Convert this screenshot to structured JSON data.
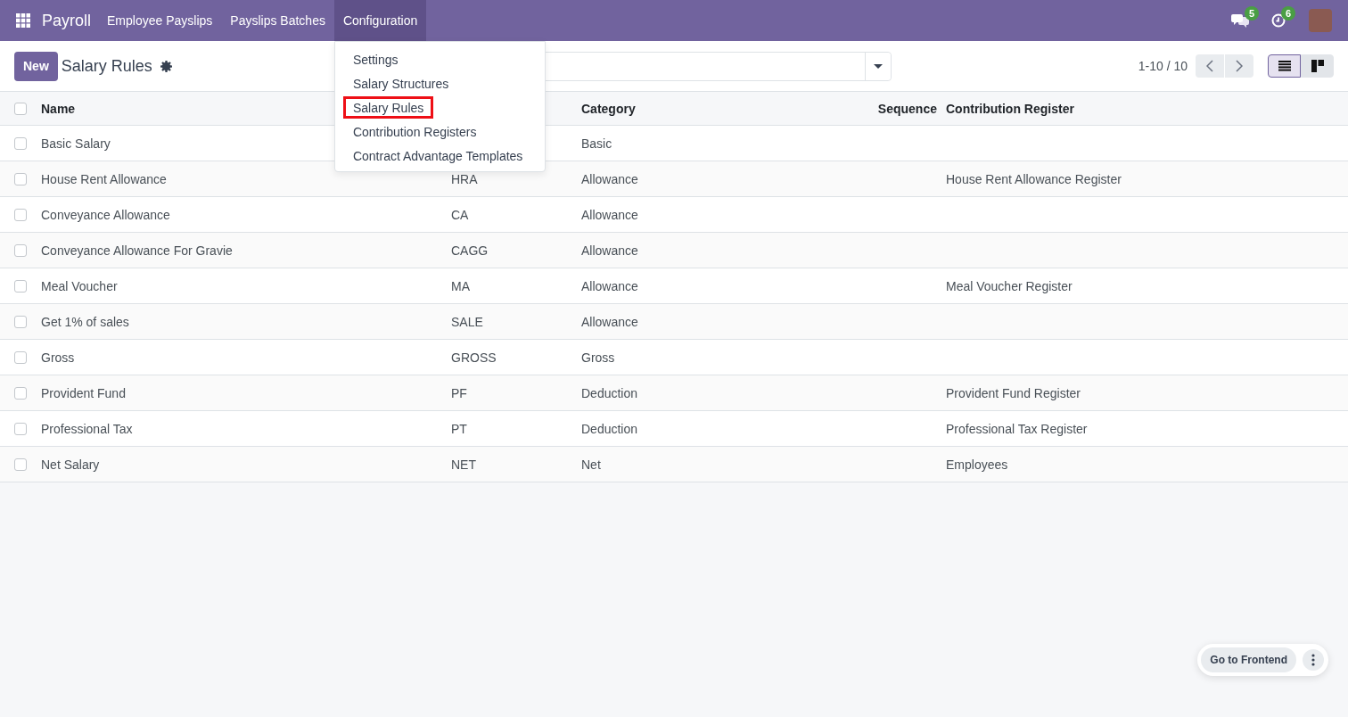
{
  "navbar": {
    "app_name": "Payroll",
    "items": [
      {
        "label": "Employee Payslips",
        "selected": false
      },
      {
        "label": "Payslips Batches",
        "selected": false
      },
      {
        "label": "Configuration",
        "selected": true,
        "menu": [
          {
            "label": "Settings",
            "highlighted": false
          },
          {
            "label": "Salary Structures",
            "highlighted": false
          },
          {
            "label": "Salary Rules",
            "highlighted": true
          },
          {
            "label": "Contribution Registers",
            "highlighted": false
          },
          {
            "label": "Contract Advantage Templates",
            "highlighted": false
          }
        ]
      }
    ],
    "messages_badge": "5",
    "activities_badge": "6"
  },
  "control_panel": {
    "new_button": "New",
    "title": "Salary Rules",
    "pager": "1-10 / 10",
    "views": [
      {
        "kind": "list",
        "selected": true
      },
      {
        "kind": "kanban",
        "selected": false
      }
    ]
  },
  "table": {
    "select_all_checked": false,
    "columns": {
      "name": "Name",
      "category": "Category",
      "sequence": "Sequence",
      "contribution_register": "Contribution Register"
    },
    "rows": [
      {
        "checked": false,
        "name": "Basic Salary",
        "category": "Basic"
      },
      {
        "checked": false,
        "name": "House Rent Allowance",
        "column_2": "HRA",
        "category": "Allowance",
        "contribution_register": "House Rent Allowance Register"
      },
      {
        "checked": false,
        "name": "Conveyance Allowance",
        "column_2": "CA",
        "category": "Allowance"
      },
      {
        "checked": false,
        "name": "Conveyance Allowance For Gravie",
        "column_2": "CAGG",
        "category": "Allowance"
      },
      {
        "checked": false,
        "name": "Meal Voucher",
        "column_2": "MA",
        "category": "Allowance",
        "contribution_register": "Meal Voucher Register"
      },
      {
        "checked": false,
        "name": "Get 1% of sales",
        "column_2": "SALE",
        "category": "Allowance"
      },
      {
        "checked": false,
        "name": "Gross",
        "column_2": "GROSS",
        "category": "Gross"
      },
      {
        "checked": false,
        "name": "Provident Fund",
        "column_2": "PF",
        "category": "Deduction",
        "contribution_register": "Provident Fund Register"
      },
      {
        "checked": false,
        "name": "Professional Tax",
        "column_2": "PT",
        "category": "Deduction",
        "contribution_register": "Professional Tax Register"
      },
      {
        "checked": false,
        "name": "Net Salary",
        "column_2": "NET",
        "category": "Net",
        "contribution_register": "Employees"
      }
    ]
  },
  "floating_toolbar": {
    "button": "Go to Frontend"
  }
}
